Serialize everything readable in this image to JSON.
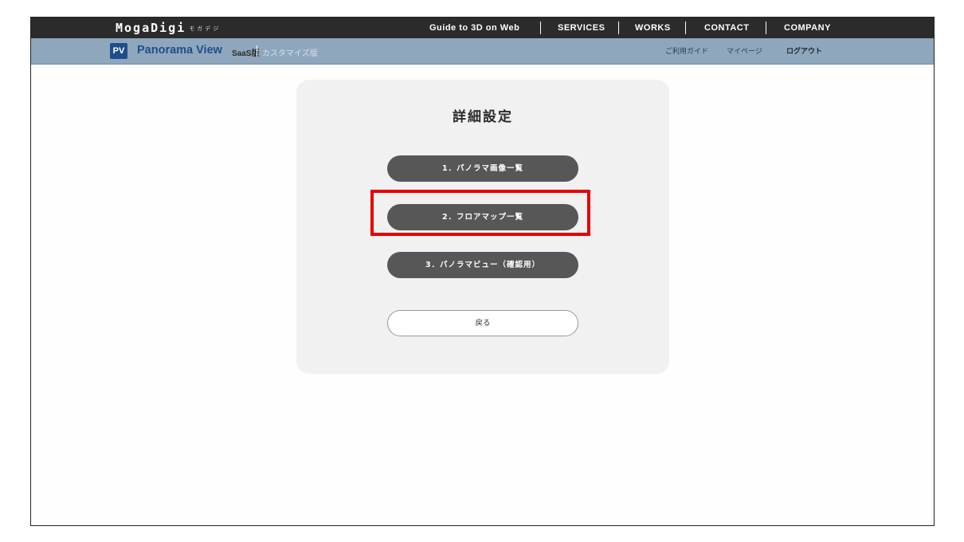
{
  "header": {
    "logo": "MogaDigi",
    "logo_sub": "モガデジ",
    "nav": [
      "Guide to 3D on Web",
      "SERVICES",
      "WORKS",
      "CONTACT",
      "COMPANY"
    ]
  },
  "subheader": {
    "badge": "PV",
    "product": "Panorama View",
    "edition": "SaaS版",
    "custom_edition": "カスタマイズ版",
    "links": [
      "ご利用ガイド",
      "マイページ",
      "ログアウト"
    ]
  },
  "panel": {
    "title": "詳細設定",
    "buttons": [
      "1．パノラマ画像一覧",
      "2．フロアマップ一覧",
      "3．パノラマビュー（確認用）"
    ],
    "back": "戻る"
  },
  "colors": {
    "topbar": "#2b2b2b",
    "subbar": "#8fa7bd",
    "brand_blue": "#1f4e8c",
    "button_dark": "#575757",
    "highlight": "#e80000"
  }
}
